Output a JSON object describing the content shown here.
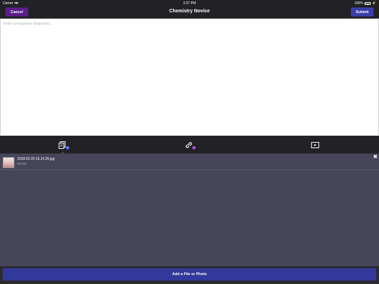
{
  "status_bar": {
    "carrier": "Carrier",
    "time": "3:37 PM",
    "battery": "100%"
  },
  "nav": {
    "cancel_label": "Cancel",
    "title": "Chemistry Novice",
    "submit_label": "Submit"
  },
  "response": {
    "placeholder": "Enter a response (required)..."
  },
  "toolbar": {
    "items": [
      {
        "icon": "files-icon",
        "badge": "1",
        "badge_color": "#4a6cf0"
      },
      {
        "icon": "link-icon",
        "badge": "0",
        "badge_color": "#a23bd6"
      },
      {
        "icon": "video-icon"
      }
    ]
  },
  "attachments": [
    {
      "name": "2018-02-20 15.14.20.jpg",
      "size": "472 KB"
    }
  ],
  "add_button_label": "Add a File or Photo",
  "colors": {
    "cancel": "#5b1e8a",
    "submit": "#3a3fa8",
    "panel": "#46455a",
    "add_button": "#33399a"
  }
}
